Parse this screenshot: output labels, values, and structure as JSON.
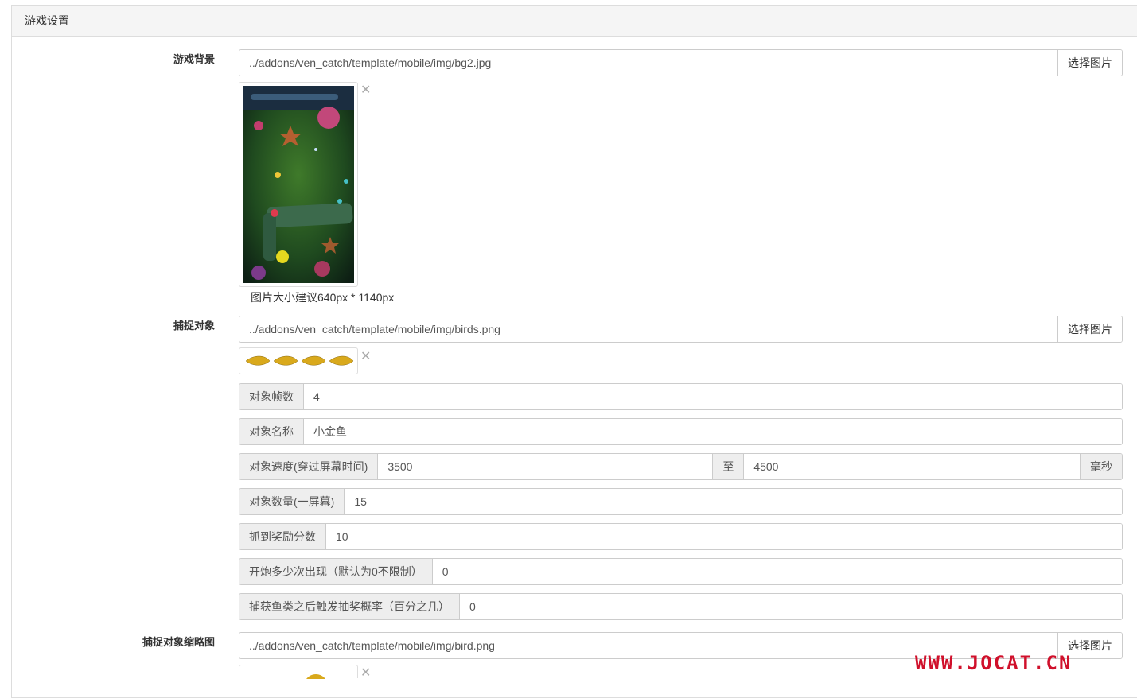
{
  "panel": {
    "title": "游戏设置"
  },
  "background": {
    "label": "游戏背景",
    "path": "../addons/ven_catch/template/mobile/img/bg2.jpg",
    "select_label": "选择图片",
    "help": "图片大小建议640px * 1140px"
  },
  "target": {
    "label": "捕捉对象",
    "path": "../addons/ven_catch/template/mobile/img/birds.png",
    "select_label": "选择图片",
    "frames": {
      "label": "对象帧数",
      "value": "4"
    },
    "name": {
      "label": "对象名称",
      "value": "小金鱼"
    },
    "speed": {
      "label": "对象速度(穿过屏幕时间)",
      "from": "3500",
      "to_label": "至",
      "to": "4500",
      "unit": "毫秒"
    },
    "count": {
      "label": "对象数量(一屏幕)",
      "value": "15"
    },
    "score": {
      "label": "抓到奖励分数",
      "value": "10"
    },
    "appear_after": {
      "label": "开炮多少次出现（默认为0不限制）",
      "value": "0"
    },
    "lottery_rate": {
      "label": "捕获鱼类之后触发抽奖概率（百分之几）",
      "value": "0"
    }
  },
  "thumbnail": {
    "label": "捕捉对象缩略图",
    "path": "../addons/ven_catch/template/mobile/img/bird.png",
    "select_label": "选择图片"
  },
  "watermark": {
    "text": "WWW.JOCAT.CN"
  },
  "icons": {
    "remove": "close-icon"
  }
}
